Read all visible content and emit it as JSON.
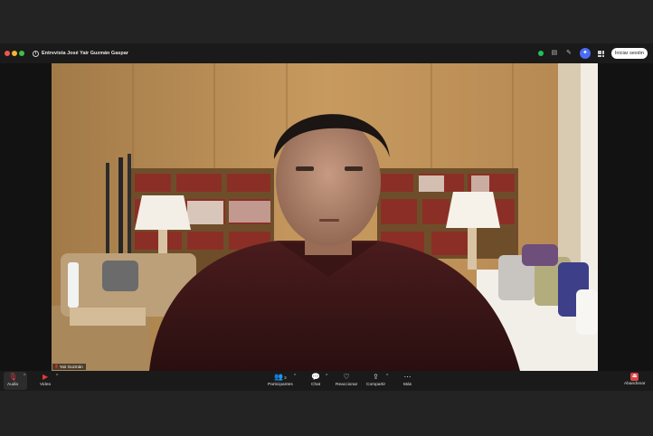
{
  "window": {
    "title": "Entrevista José Yair Guzmán Gaspar",
    "signin_label": "Iniciar sesión"
  },
  "video": {
    "participant_name": "Yair Guzmán"
  },
  "toolbar": {
    "audio_label": "Audio",
    "video_label": "Video",
    "participants_label": "Participantes",
    "participants_count": "3",
    "chat_label": "Chat",
    "react_label": "Reaccionar",
    "share_label": "Compartir",
    "more_label": "Más",
    "leave_label": "Abandonar"
  },
  "colors": {
    "toolbar_bg": "#1a1a1a",
    "muted_red": "#e03b3b",
    "leave_red": "#d64545",
    "status_green": "#21c15a",
    "accent_blue": "#4a6cf7"
  },
  "icons": [
    "info-icon",
    "shield-icon",
    "edit-icon",
    "sparkle-icon",
    "grid-icon",
    "mic-muted-icon",
    "video-muted-icon",
    "participants-icon",
    "chat-icon",
    "heart-icon",
    "share-icon",
    "more-icon",
    "leave-icon"
  ]
}
